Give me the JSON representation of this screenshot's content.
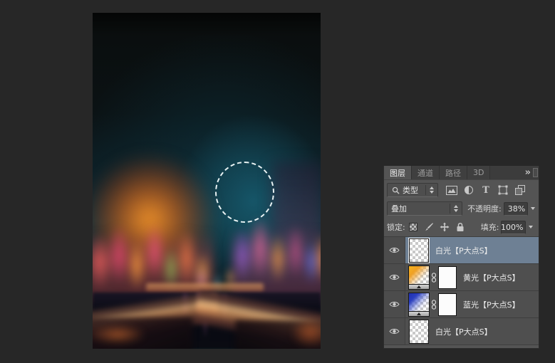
{
  "layers_panel": {
    "tabs": [
      {
        "label": "图层",
        "active": true
      },
      {
        "label": "通道",
        "active": false
      },
      {
        "label": "路径",
        "active": false
      },
      {
        "label": "3D",
        "active": false
      }
    ],
    "collapse_glyph": "»",
    "filter": {
      "kind_label": "类型",
      "type_filter_glyph": "T"
    },
    "blend": {
      "mode": "叠加",
      "opacity_label": "不透明度:",
      "opacity_value": "38%"
    },
    "lock": {
      "label": "锁定:",
      "fill_label": "填充:",
      "fill_value": "100%"
    },
    "layers": [
      {
        "name": "白光【P大点S】",
        "selected": true,
        "visible": true,
        "thumb": "transparent-checker"
      },
      {
        "name": "黄光【P大点S】",
        "selected": false,
        "visible": true,
        "thumb": "yellow-gradient",
        "has_mask": true
      },
      {
        "name": "蓝光【P大点S】",
        "selected": false,
        "visible": true,
        "thumb": "blue-gradient",
        "has_mask": true
      },
      {
        "name": "白光【P大点S】",
        "selected": false,
        "visible": true,
        "thumb": "transparent-checker"
      }
    ],
    "colors": {
      "selected_row": "#6e8094",
      "panel_bg": "#545454",
      "row_bg": "#4f4f4f",
      "workspace_bg": "#272727"
    }
  }
}
